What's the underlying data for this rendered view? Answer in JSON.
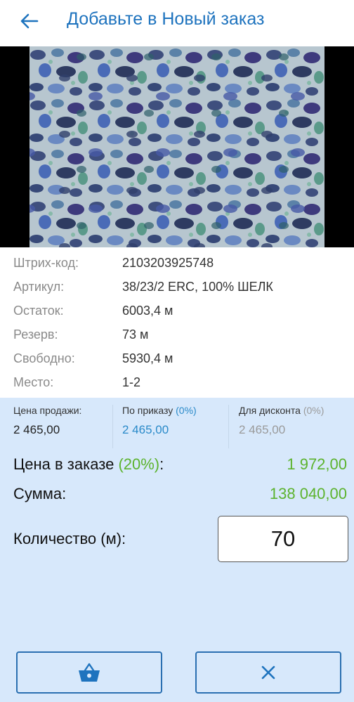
{
  "header": {
    "title": "Добавьте в Новый заказ",
    "back_icon": "arrow-left-icon"
  },
  "product": {
    "image_alt": "Ткань с леопардовым принтом",
    "fields": [
      {
        "key": "Штрих-код:",
        "value": "2103203925748"
      },
      {
        "key": "Артикул:",
        "value": "38/23/2 ERC, 100% ШЕЛК"
      },
      {
        "key": "Остаток:",
        "value": "6003,4 м"
      },
      {
        "key": "Резерв:",
        "value": "73 м"
      },
      {
        "key": "Свободно:",
        "value": "5930,4 м"
      },
      {
        "key": "Место:",
        "value": "1-2"
      }
    ]
  },
  "prices": {
    "sale": {
      "label": "Цена продажи:",
      "value": "2 465,00"
    },
    "by_order": {
      "label": "По приказу",
      "pct": "(0%)",
      "value": "2 465,00"
    },
    "discount": {
      "label": "Для дисконта",
      "pct": "(0%)",
      "value": "2 465,00"
    }
  },
  "order": {
    "price_label": "Цена в заказе",
    "price_pct": "(20%)",
    "price_colon": ":",
    "price_value": "1 972,00",
    "sum_label": "Сумма:",
    "sum_value": "138 040,00",
    "qty_label": "Количество (м):",
    "qty_value": "70"
  },
  "actions": {
    "basket_icon": "basket-icon",
    "close_icon": "close-icon"
  },
  "colors": {
    "accent": "#1e73be",
    "panel": "#d7e8fb",
    "green": "#5cb32e",
    "blue_text": "#2a8ac9"
  }
}
